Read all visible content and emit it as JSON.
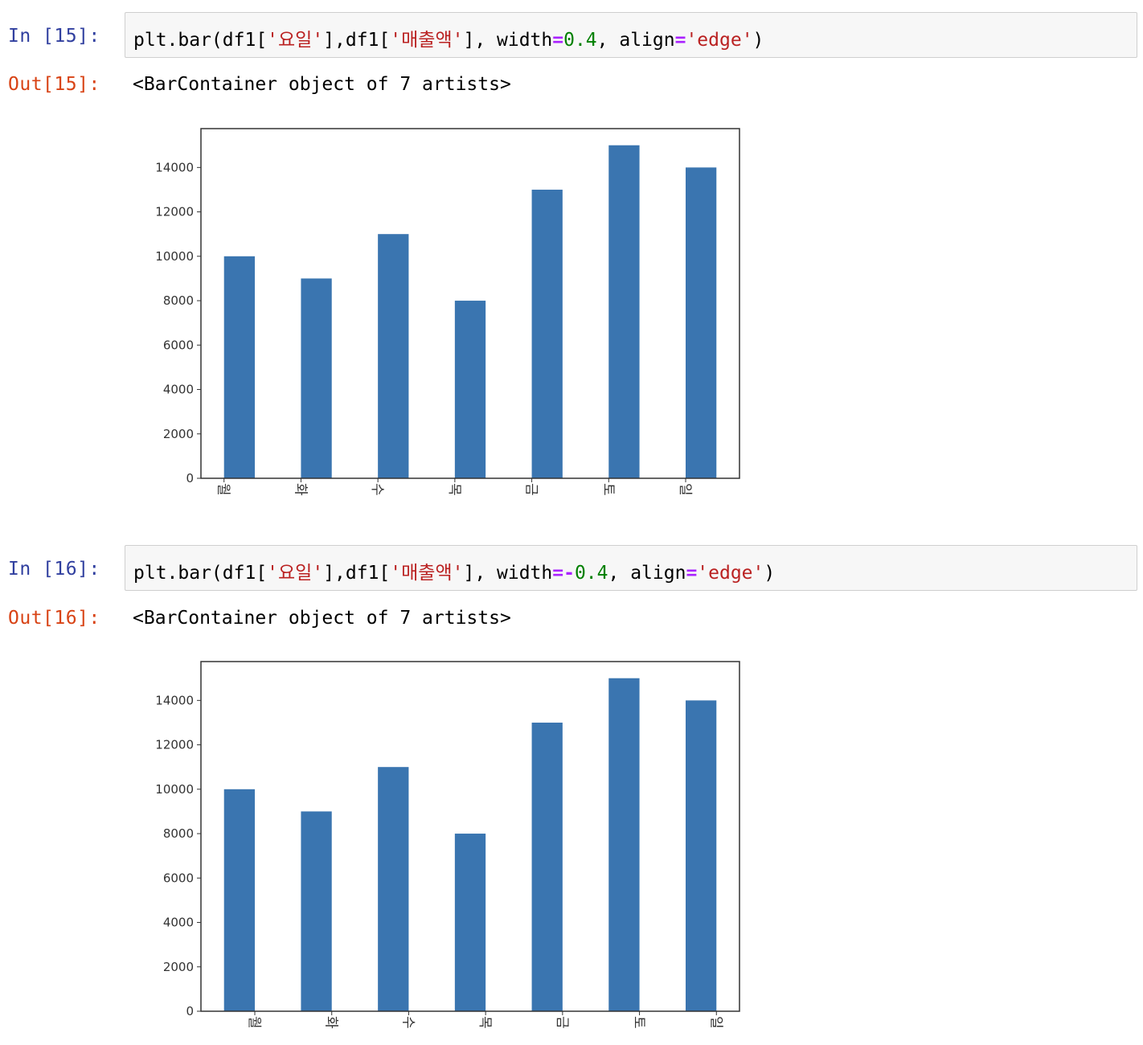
{
  "cells": [
    {
      "in_prompt": "In [15]:",
      "code": {
        "p1": "plt.bar(df1[",
        "s1": "'요일'",
        "p2": "],df1[",
        "s2": "'매출액'",
        "p3": "], width",
        "eq1": "=",
        "num": "0.4",
        "p4": ", align",
        "eq2": "=",
        "s3": "'edge'",
        "p5": ")"
      },
      "out_prompt": "Out[15]:",
      "out_text": "<BarContainer object of 7 artists>"
    },
    {
      "in_prompt": "In [16]:",
      "code": {
        "p1": "plt.bar(df1[",
        "s1": "'요일'",
        "p2": "],df1[",
        "s2": "'매출액'",
        "p3": "], width",
        "eq1": "=-",
        "num": "0.4",
        "p4": ", align",
        "eq2": "=",
        "s3": "'edge'",
        "p5": ")"
      },
      "out_prompt": "Out[16]:",
      "out_text": "<BarContainer object of 7 artists>"
    }
  ],
  "chart_data": [
    {
      "type": "bar",
      "categories": [
        "월",
        "화",
        "수",
        "목",
        "금",
        "토",
        "일"
      ],
      "values": [
        10000,
        9000,
        11000,
        8000,
        13000,
        15000,
        14000
      ],
      "bar_width": 0.4,
      "align": "edge",
      "yticks": [
        0,
        2000,
        4000,
        6000,
        8000,
        10000,
        12000,
        14000
      ],
      "xlim": [
        -0.3,
        6.7
      ],
      "ylim": [
        0,
        15750
      ],
      "bar_color": "#3a75b0",
      "grid": false
    },
    {
      "type": "bar",
      "categories": [
        "월",
        "화",
        "수",
        "목",
        "금",
        "토",
        "일"
      ],
      "values": [
        10000,
        9000,
        11000,
        8000,
        13000,
        15000,
        14000
      ],
      "bar_width": -0.4,
      "align": "edge",
      "yticks": [
        0,
        2000,
        4000,
        6000,
        8000,
        10000,
        12000,
        14000
      ],
      "xlim": [
        -0.7,
        6.3
      ],
      "ylim": [
        0,
        15750
      ],
      "bar_color": "#3a75b0",
      "grid": false
    }
  ]
}
